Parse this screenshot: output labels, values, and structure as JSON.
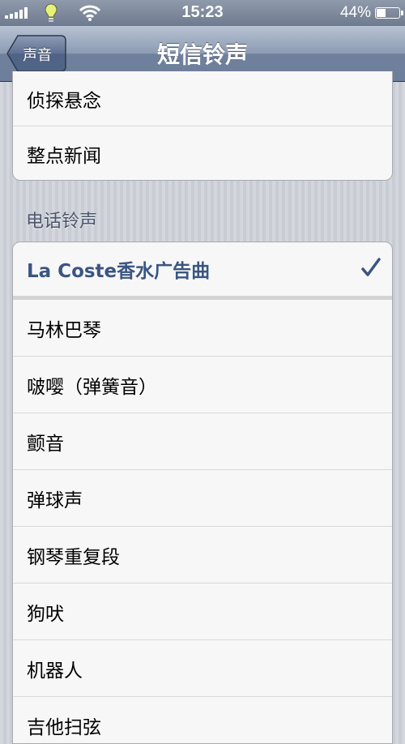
{
  "status_bar": {
    "time": "15:23",
    "battery_percent_text": "44%",
    "battery_level": 0.44,
    "icons": [
      "signal-icon",
      "lightbulb-icon",
      "wifi-icon",
      "battery-icon"
    ]
  },
  "nav": {
    "back_label": "声音",
    "title": "短信铃声"
  },
  "section_top": {
    "items": [
      {
        "label": "侦探悬念"
      },
      {
        "label": "整点新闻"
      }
    ]
  },
  "section_ringtones": {
    "header": "电话铃声",
    "items": [
      {
        "label": "La Coste香水广告曲",
        "selected": true
      },
      {
        "label": "马林巴琴"
      },
      {
        "label": "啵嘤（弹簧音）"
      },
      {
        "label": "颤音"
      },
      {
        "label": "弹球声"
      },
      {
        "label": "钢琴重复段"
      },
      {
        "label": "狗吠"
      },
      {
        "label": "机器人"
      },
      {
        "label": "吉他扫弦"
      }
    ]
  },
  "colors": {
    "selected_text": "#3a5582",
    "nav_bar": "#6f809d",
    "background": "#c8ccd4"
  }
}
